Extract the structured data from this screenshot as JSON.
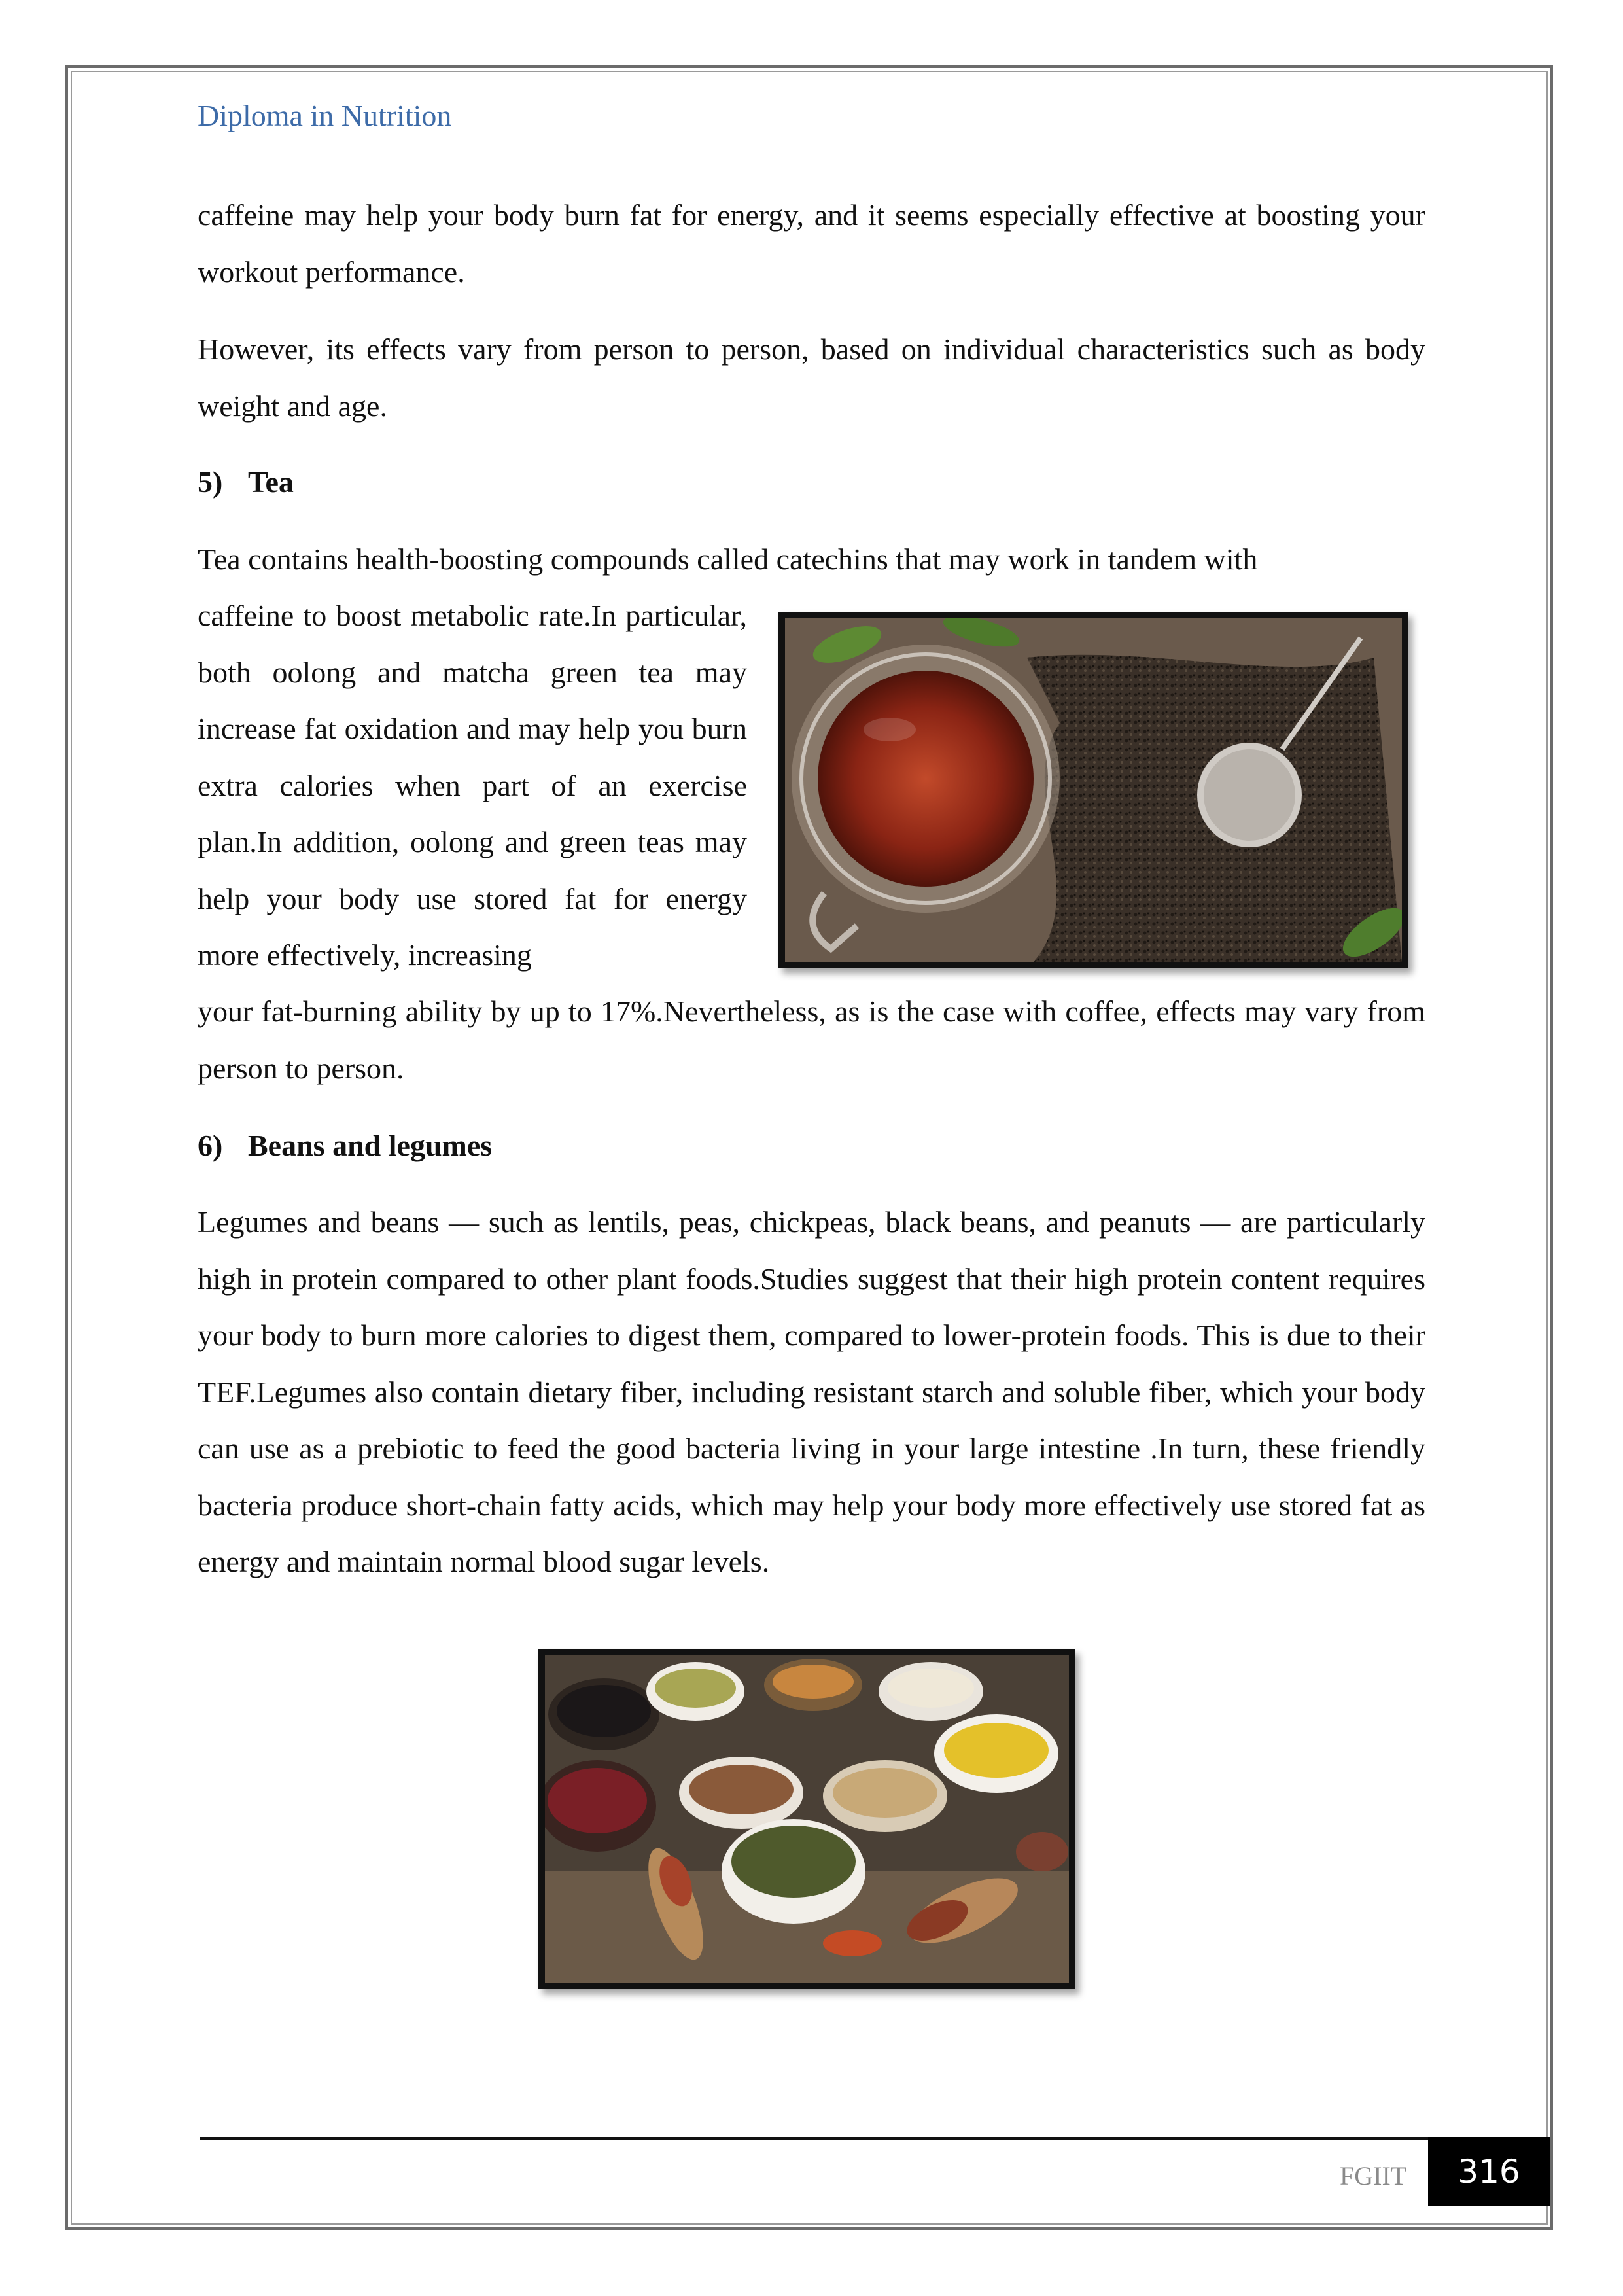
{
  "header": {
    "title": "Diploma in Nutrition"
  },
  "body": {
    "p1": "caffeine may help your body burn fat for energy, and it seems especially effective at boosting your workout performance.",
    "p2": "However, its effects vary from person to person, based on individual characteristics such as body weight and age.",
    "tea": {
      "number": "5)",
      "title": "Tea",
      "line1": "Tea contains health-boosting compounds called catechins that may work in tandem with",
      "wrapped": "caffeine to boost metabolic rate.In particular, both oolong and matcha green tea may increase fat oxidation and may help you burn extra calories when part of an exercise plan.In addition, oolong and green teas may help your body use stored fat for energy more effectively, increasing",
      "rest": "your fat-burning ability by up to 17%.Nevertheless, as is the case with coffee, effects may vary from person to person."
    },
    "beans": {
      "number": "6)",
      "title": "Beans and legumes",
      "text": "Legumes and beans — such as lentils, peas, chickpeas, black beans, and peanuts — are particularly high in protein compared to other plant foods.Studies suggest that their high protein content requires your body to burn more calories to digest them, compared to lower-protein foods. This is due to their TEF.Legumes also contain dietary fiber, including resistant starch and soluble fiber, which your body can use as a prebiotic to feed the good bacteria living in your large intestine .In turn, these friendly bacteria produce short-chain fatty acids, which may help your body more effectively use stored fat as energy and maintain normal blood sugar levels."
    }
  },
  "footer": {
    "label": "FGIIT",
    "page_number": "316"
  }
}
